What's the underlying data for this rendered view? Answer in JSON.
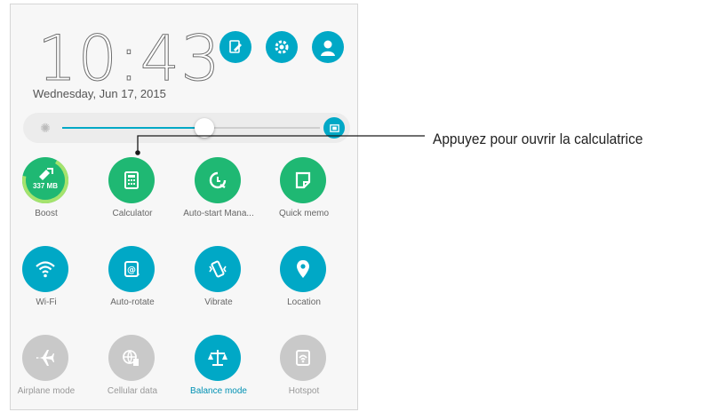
{
  "status": {
    "time": "10:43",
    "date": "Wednesday, Jun 17, 2015"
  },
  "top_actions": [
    {
      "name": "edit-icon"
    },
    {
      "name": "settings-icon"
    },
    {
      "name": "user-icon"
    }
  ],
  "brightness": {
    "level": 0.55,
    "low_icon": "sun-icon",
    "auto_icon": "auto-brightness-icon"
  },
  "tiles": [
    {
      "label": "Boost",
      "icon": "boost-icon",
      "state": "active",
      "badge": "337 MB"
    },
    {
      "label": "Calculator",
      "icon": "calculator-icon",
      "state": "active"
    },
    {
      "label": "Auto-start Mana...",
      "icon": "auto-start-icon",
      "state": "active"
    },
    {
      "label": "Quick memo",
      "icon": "memo-icon",
      "state": "active"
    },
    {
      "label": "Wi-Fi",
      "icon": "wifi-icon",
      "state": "on"
    },
    {
      "label": "Auto-rotate",
      "icon": "auto-rotate-icon",
      "state": "on"
    },
    {
      "label": "Vibrate",
      "icon": "vibrate-icon",
      "state": "on"
    },
    {
      "label": "Location",
      "icon": "location-icon",
      "state": "on"
    },
    {
      "label": "Airplane mode",
      "icon": "airplane-icon",
      "state": "off"
    },
    {
      "label": "Cellular data",
      "icon": "cellular-data-icon",
      "state": "off"
    },
    {
      "label": "Balance mode",
      "icon": "balance-icon",
      "state": "on"
    },
    {
      "label": "Hotspot",
      "icon": "hotspot-icon",
      "state": "off"
    }
  ],
  "callout": {
    "text": "Appuyez pour ouvrir la calculatrice"
  },
  "colors": {
    "green": "#1fb873",
    "blue": "#00a8c6",
    "gray": "#c9c9c9",
    "label_active": "#0091b3"
  }
}
